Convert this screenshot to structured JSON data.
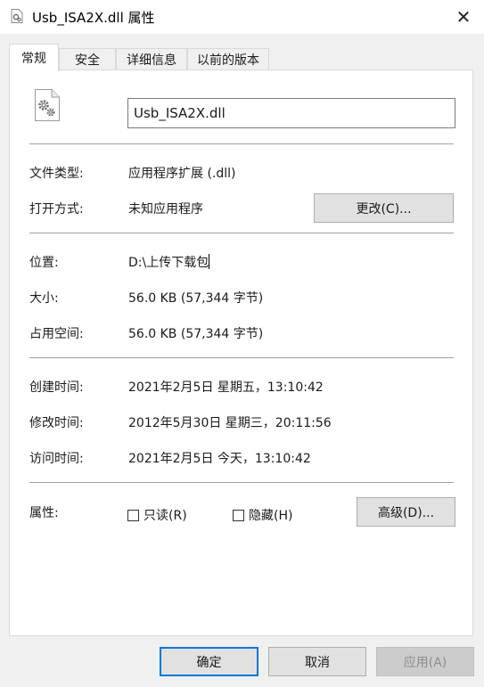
{
  "window": {
    "title": "Usb_ISA2X.dll 属性",
    "close_glyph": "✕"
  },
  "tabs": [
    {
      "label": "常规",
      "active": true
    },
    {
      "label": "安全",
      "active": false
    },
    {
      "label": "详细信息",
      "active": false
    },
    {
      "label": "以前的版本",
      "active": false
    }
  ],
  "file": {
    "name": "Usb_ISA2X.dll",
    "icon": "dll-settings-icon"
  },
  "info": {
    "type_label": "文件类型:",
    "type_value": "应用程序扩展 (.dll)",
    "openwith_label": "打开方式:",
    "openwith_value": "未知应用程序",
    "change_button": "更改(C)...",
    "location_label": "位置:",
    "location_value": "D:\\上传下载包",
    "size_label": "大小:",
    "size_value": "56.0 KB (57,344 字节)",
    "disk_label": "占用空间:",
    "disk_value": "56.0 KB (57,344 字节)",
    "created_label": "创建时间:",
    "created_value": "2021年2月5日 星期五，13:10:42",
    "modified_label": "修改时间:",
    "modified_value": "2012年5月30日 星期三，20:11:56",
    "accessed_label": "访问时间:",
    "accessed_value": "2021年2月5日 今天，13:10:42",
    "attr_label": "属性:",
    "readonly_label": "只读(R)",
    "hidden_label": "隐藏(H)",
    "advanced_button": "高级(D)..."
  },
  "footer": {
    "ok": "确定",
    "cancel": "取消",
    "apply": "应用(A)"
  },
  "colors": {
    "accent": "#0078d7",
    "window_bg": "#f0f0f0",
    "panel_bg": "#ffffff"
  }
}
